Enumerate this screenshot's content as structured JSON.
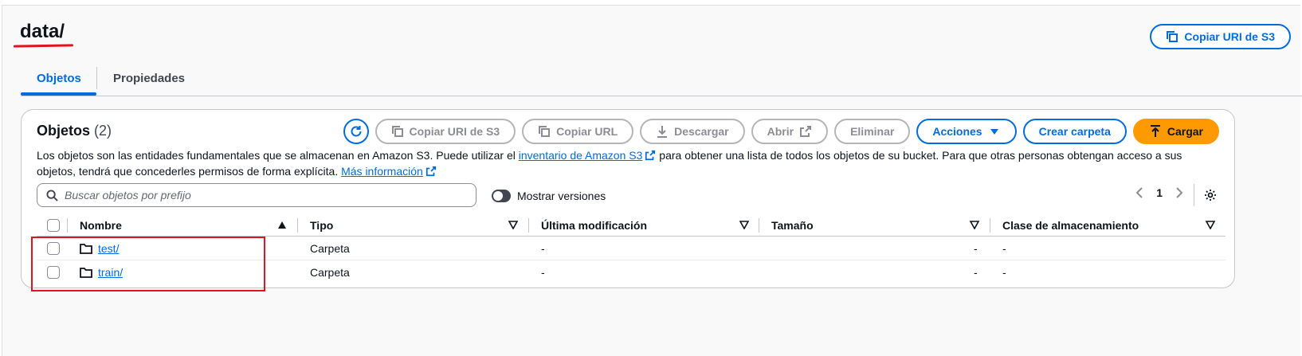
{
  "header": {
    "title": "data/",
    "copy_uri_label": "Copiar URI de S3"
  },
  "tabs": [
    {
      "label": "Objetos",
      "active": true
    },
    {
      "label": "Propiedades",
      "active": false
    }
  ],
  "objects_panel": {
    "title": "Objetos",
    "count": "(2)",
    "toolbar": {
      "refresh_icon": "refresh-icon",
      "copy_s3_uri": "Copiar URI de S3",
      "copy_url": "Copiar URL",
      "download": "Descargar",
      "open": "Abrir",
      "delete": "Eliminar",
      "actions": "Acciones",
      "create_folder": "Crear carpeta",
      "upload": "Cargar"
    },
    "description": {
      "part1": "Los objetos son las entidades fundamentales que se almacenan en Amazon S3. Puede utilizar el ",
      "inventory_link": "inventario de Amazon S3",
      "part2": " para obtener una lista de todos los objetos de su bucket. Para que otras personas obtengan acceso a sus objetos, tendrá que concederles permisos de forma explícita. ",
      "more_info_link": "Más información"
    },
    "search": {
      "placeholder": "Buscar objetos por prefijo"
    },
    "versions_toggle": {
      "label": "Mostrar versiones",
      "on": false
    },
    "pagination": {
      "current_page": "1"
    },
    "table": {
      "columns": [
        "Nombre",
        "Tipo",
        "Última modificación",
        "Tamaño",
        "Clase de almacenamiento"
      ],
      "rows": [
        {
          "name": "test/",
          "type": "Carpeta",
          "last_modified": "-",
          "size": "-",
          "storage_class": "-"
        },
        {
          "name": "train/",
          "type": "Carpeta",
          "last_modified": "-",
          "size": "-",
          "storage_class": "-"
        }
      ]
    }
  },
  "colors": {
    "accent": "#006ce0",
    "primary_button": "#ff9900",
    "annotation": "#e0141e"
  }
}
